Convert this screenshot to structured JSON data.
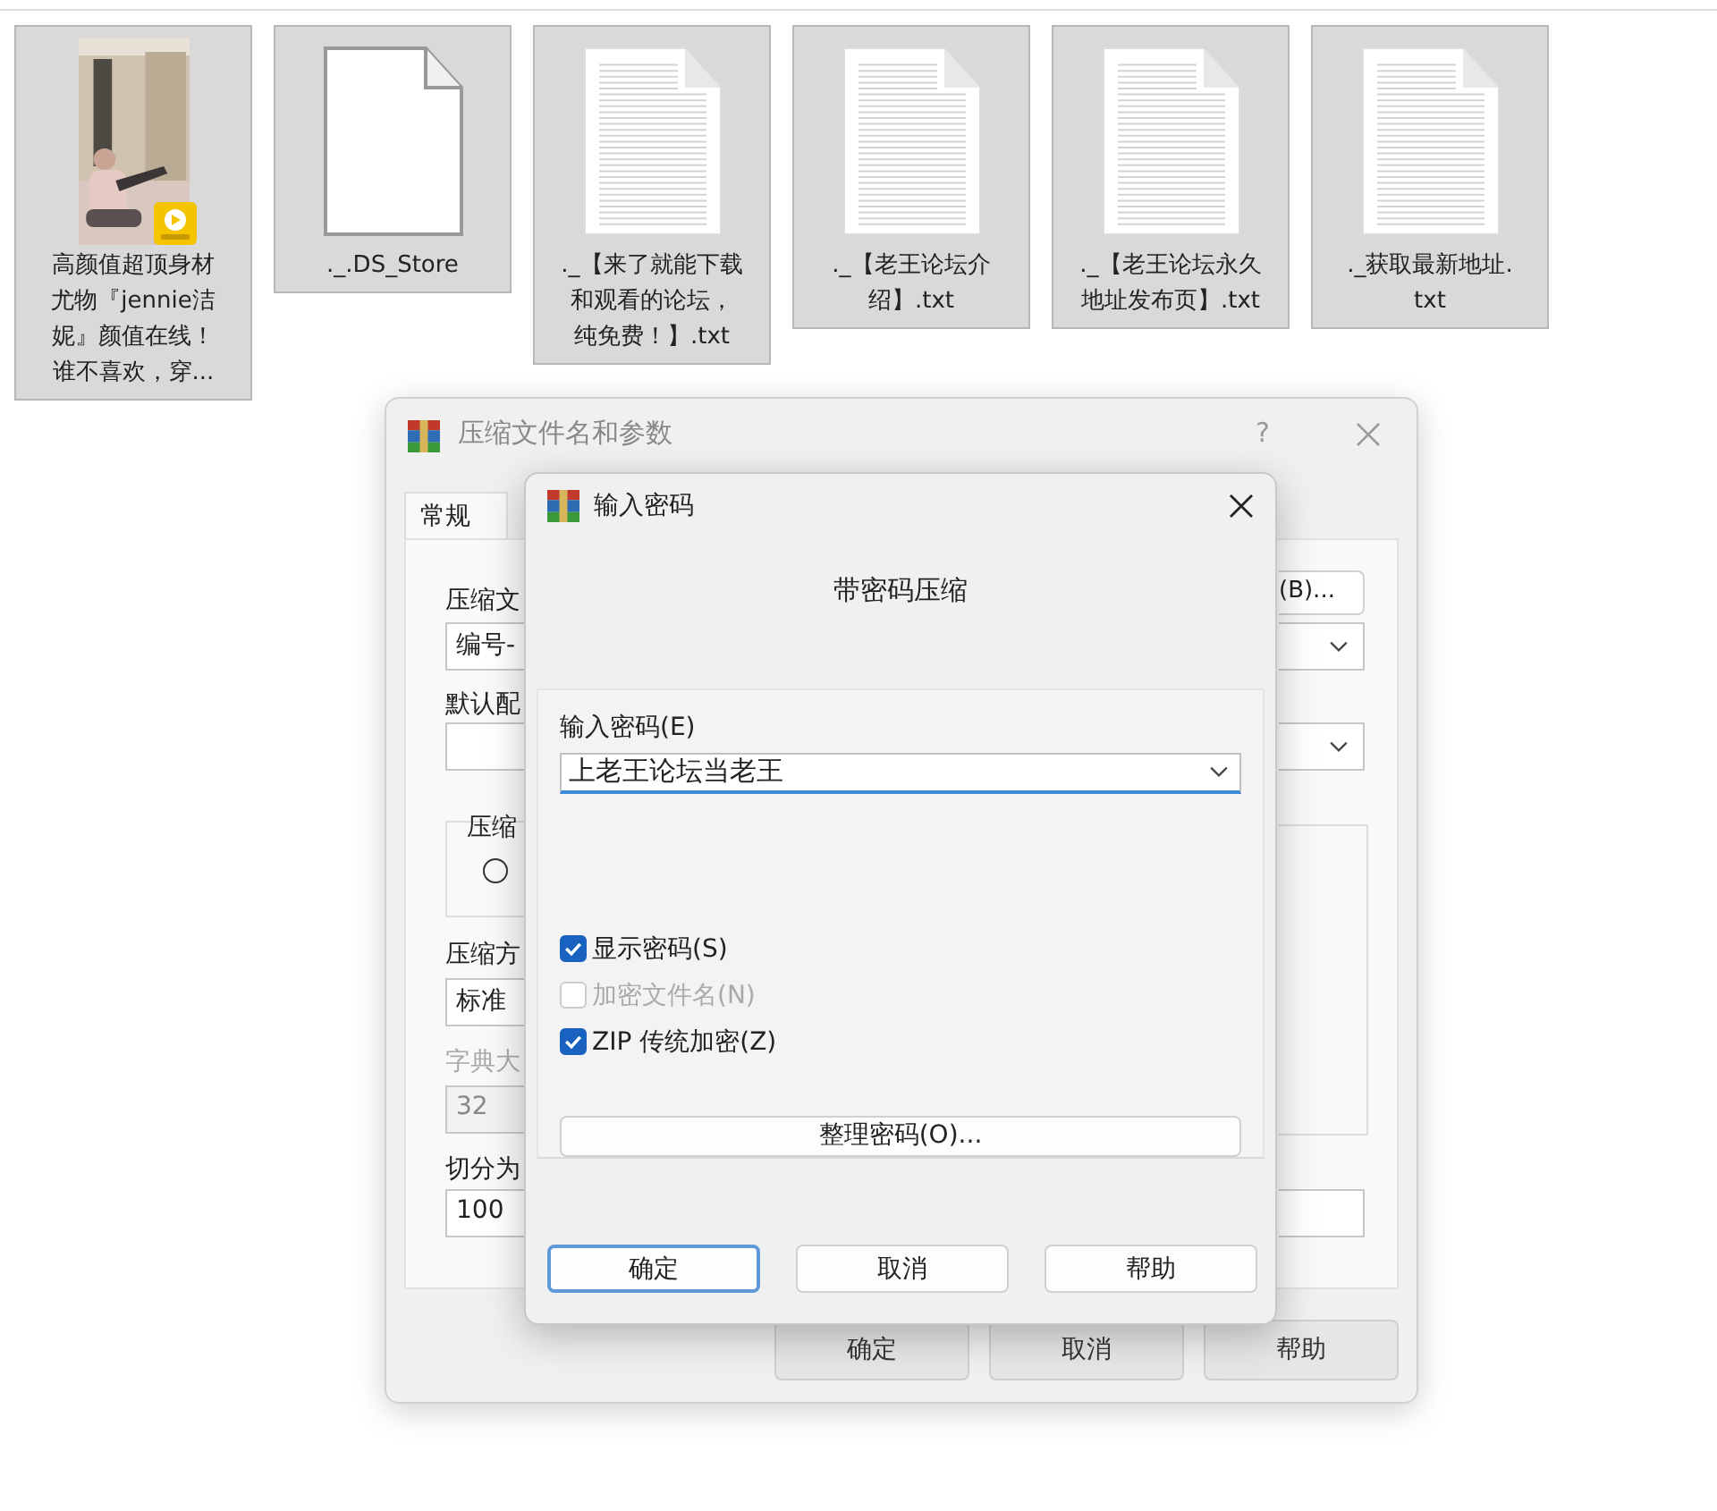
{
  "files": [
    {
      "kind": "video",
      "lines": [
        "高颜值超顶身材",
        "尤物『jennie洁",
        "妮』颜值在线！",
        "谁不喜欢，穿..."
      ]
    },
    {
      "kind": "blank",
      "lines": [
        "._.DS_Store"
      ]
    },
    {
      "kind": "text",
      "lines": [
        "._【来了就能下载",
        "和观看的论坛，",
        "纯免费！】.txt"
      ]
    },
    {
      "kind": "text",
      "lines": [
        "._【老王论坛介",
        "绍】.txt"
      ]
    },
    {
      "kind": "text",
      "lines": [
        "._【老王论坛永久",
        "地址发布页】.txt"
      ]
    },
    {
      "kind": "text",
      "lines": [
        "._获取最新地址.",
        "txt"
      ]
    }
  ],
  "back_dialog": {
    "title": "压缩文件名和参数",
    "help": "?",
    "tabs": [
      {
        "label": "常规",
        "selected": true
      }
    ],
    "browse_button": "(B)...",
    "archive_label": "压缩文",
    "archive_value": "编号-",
    "profile_label": "默认配",
    "update_group_label": "压缩",
    "radio_selected": false,
    "method_label": "压缩方",
    "method_value": "标准",
    "dict_label": "字典大",
    "dict_value": "32",
    "dict_disabled": true,
    "split_label": "切分为",
    "split_value": "100",
    "buttons": [
      "确定",
      "取消",
      "帮助"
    ]
  },
  "password_dialog": {
    "title": "输入密码",
    "heading": "带密码压缩",
    "password_label": "输入密码(E)",
    "password_value": "上老王论坛当老王",
    "options": [
      {
        "label": "显示密码(S)",
        "checked": true,
        "disabled": false
      },
      {
        "label": "加密文件名(N)",
        "checked": false,
        "disabled": true
      },
      {
        "label": "ZIP 传统加密(Z)",
        "checked": true,
        "disabled": false
      }
    ],
    "organize_button": "整理密码(O)...",
    "buttons": [
      {
        "label": "确定",
        "default": true
      },
      {
        "label": "取消",
        "default": false
      },
      {
        "label": "帮助",
        "default": false
      }
    ]
  }
}
